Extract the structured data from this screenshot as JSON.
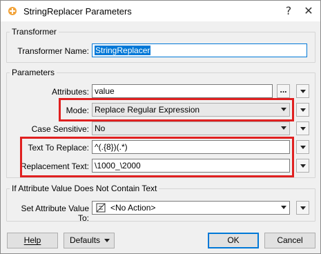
{
  "window": {
    "title": "StringReplacer Parameters",
    "help_glyph": "?",
    "close_glyph": "✕"
  },
  "transformer": {
    "group_title": "Transformer",
    "name_label": "Transformer Name:",
    "name_value": "StringReplacer"
  },
  "parameters": {
    "group_title": "Parameters",
    "attributes_label": "Attributes:",
    "attributes_value": "value",
    "attributes_browse": "...",
    "mode_label": "Mode:",
    "mode_value": "Replace Regular Expression",
    "case_label": "Case Sensitive:",
    "case_value": "No",
    "text_to_replace_label": "Text To Replace:",
    "text_to_replace_value": "^(.{8})(.*)",
    "replacement_label": "Replacement Text:",
    "replacement_value": "\\1000_\\2000"
  },
  "no_text": {
    "group_title": "If Attribute Value Does Not Contain Text",
    "set_label": "Set Attribute Value To:",
    "set_value": "<No Action>"
  },
  "buttons": {
    "help": "Help",
    "defaults": "Defaults",
    "ok": "OK",
    "cancel": "Cancel"
  },
  "colors": {
    "highlight": "#e02020",
    "accent": "#0078d7"
  }
}
